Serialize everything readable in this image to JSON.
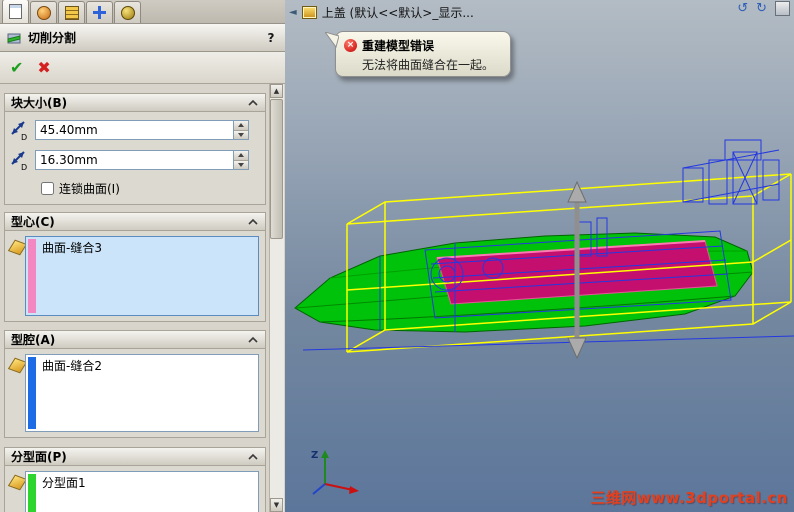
{
  "icons": {
    "help": "?",
    "ok": "✔",
    "cancel": "✖",
    "scroll_up": "▲",
    "scroll_down": "▼",
    "collapse_left": "◄",
    "error": "×",
    "undo_view": "↺",
    "redo_view": "↻",
    "dim_letter": "D"
  },
  "panel": {
    "title": "切削分割",
    "block_size": {
      "label": "块大小(B)",
      "dim1": "45.40mm",
      "dim2": "16.30mm",
      "interlock_label": "连锁曲面(I)"
    },
    "core": {
      "label": "型心(C)",
      "item": "曲面-缝合3",
      "color": "#F387C2"
    },
    "cavity": {
      "label": "型腔(A)",
      "item": "曲面-缝合2",
      "color": "#1E6BE6"
    },
    "parting": {
      "label": "分型面(P)",
      "item": "分型面1",
      "color": "#2FD52F"
    }
  },
  "viewport": {
    "breadcrumb": "上盖 (默认<<默认>_显示...",
    "error_balloon": {
      "title": "重建模型错误",
      "message": "无法将曲面缝合在一起。"
    },
    "triad": {
      "z_label": "Z"
    },
    "watermark": "三维网www.3dportal.cn",
    "colors": {
      "surface_green": "#00C20A",
      "cavity_magenta": "#C40F6E",
      "bounding_box_yellow": "#FFFF00",
      "wireframe_blue": "#2438E0"
    }
  }
}
